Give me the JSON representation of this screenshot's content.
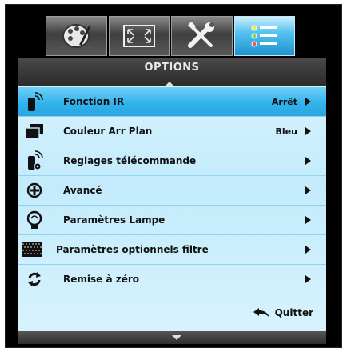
{
  "header": {
    "title": "OPTIONS"
  },
  "tabs": [
    {
      "icon": "palette-icon",
      "active": false
    },
    {
      "icon": "screen-resize-icon",
      "active": false
    },
    {
      "icon": "tools-icon",
      "active": false
    },
    {
      "icon": "list-menu-icon",
      "active": true
    }
  ],
  "menu": {
    "items": [
      {
        "label": "Fonction IR",
        "value": "Arrêt",
        "icon": "ir-remote-icon",
        "selected": true
      },
      {
        "label": "Couleur Arr Plan",
        "value": "Bleu",
        "icon": "background-color-icon",
        "selected": false
      },
      {
        "label": "Reglages télécommande",
        "value": "",
        "icon": "remote-settings-icon",
        "selected": false
      },
      {
        "label": "Avancé",
        "value": "",
        "icon": "advanced-icon",
        "selected": false
      },
      {
        "label": "Paramètres Lampe",
        "value": "",
        "icon": "lamp-icon",
        "selected": false
      },
      {
        "label": "Paramètres optionnels filtre",
        "value": "",
        "icon": "filter-icon",
        "selected": false
      },
      {
        "label": "Remise à zéro",
        "value": "",
        "icon": "reset-icon",
        "selected": false
      }
    ],
    "quit_label": "Quitter"
  },
  "colors": {
    "accent": "#32b3ec",
    "menu_bg": "#c9eefc",
    "frame": "#000000"
  }
}
